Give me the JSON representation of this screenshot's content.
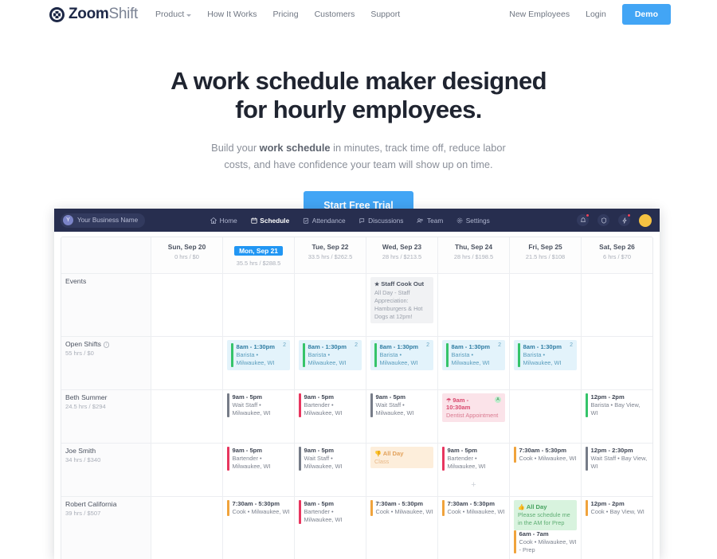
{
  "site_nav": {
    "brand": {
      "part1": "Zoom",
      "part2": "Shift",
      "icon": "zoomshift-logo-icon"
    },
    "links": [
      {
        "label": "Product",
        "has_caret": true
      },
      {
        "label": "How It Works",
        "has_caret": false
      },
      {
        "label": "Pricing",
        "has_caret": false
      },
      {
        "label": "Customers",
        "has_caret": false
      },
      {
        "label": "Support",
        "has_caret": false
      }
    ],
    "right": [
      {
        "label": "New Employees"
      },
      {
        "label": "Login"
      }
    ],
    "demo_button": "Demo",
    "accent_color": "#42a5f5"
  },
  "hero": {
    "heading_line1": "A work schedule maker designed for",
    "heading_line2": "hourly employees.",
    "sub_pre": "Build your ",
    "sub_bold": "work schedule",
    "sub_post": " in minutes, track time off, reduce labor costs, and have confidence your team will show up on time.",
    "cta_label": "Start Free Trial"
  },
  "app": {
    "business_name": "Your Business Name",
    "business_initial": "Y",
    "menu": [
      {
        "label": "Home",
        "icon": "home-icon",
        "active": false
      },
      {
        "label": "Schedule",
        "icon": "calendar-icon",
        "active": true
      },
      {
        "label": "Attendance",
        "icon": "clipboard-check-icon",
        "active": false
      },
      {
        "label": "Discussions",
        "icon": "chat-icon",
        "active": false
      },
      {
        "label": "Team",
        "icon": "people-icon",
        "active": false
      },
      {
        "label": "Settings",
        "icon": "gear-icon",
        "active": false
      }
    ],
    "nav_icons": [
      {
        "name": "bell-icon",
        "has_dot": true
      },
      {
        "name": "shield-icon",
        "has_dot": false
      },
      {
        "name": "lightning-icon",
        "has_dot": true
      }
    ],
    "avatar": "user-avatar"
  },
  "calendar": {
    "days": [
      {
        "label": "Sun, Sep 20",
        "sub": "0 hrs / $0",
        "selected": false
      },
      {
        "label": "Mon, Sep 21",
        "sub": "35.5 hrs / $288.5",
        "selected": true
      },
      {
        "label": "Tue, Sep 22",
        "sub": "33.5 hrs / $262.5",
        "selected": false
      },
      {
        "label": "Wed, Sep 23",
        "sub": "28 hrs / $213.5",
        "selected": false
      },
      {
        "label": "Thu, Sep 24",
        "sub": "28 hrs / $198.5",
        "selected": false
      },
      {
        "label": "Fri, Sep 25",
        "sub": "21.5 hrs / $108",
        "selected": false
      },
      {
        "label": "Sat, Sep 26",
        "sub": "6 hrs / $70",
        "selected": false
      }
    ],
    "events_row": {
      "label": "Events",
      "event": {
        "title": "Staff Cook Out",
        "desc": "All Day - Staff Appreciation: Hamburgers & Hot Dogs at 12pm!",
        "icon": "star-icon",
        "day_index": 3
      }
    },
    "open_shifts_row": {
      "label": "Open Shifts",
      "sub": "55 hrs / $0",
      "card_time": "8am - 1:30pm",
      "card_desc": "Barista • Milwaukee, WI",
      "count": "2",
      "day_indexes": [
        1,
        2,
        3,
        4,
        5
      ]
    },
    "employees": [
      {
        "name": "Beth Summer",
        "sub": "24.5 hrs / $294",
        "cells": [
          {},
          {
            "type": "shift",
            "time": "9am - 5pm",
            "desc": "Wait Staff • Milwaukee, WI",
            "color": "#767c88"
          },
          {
            "type": "shift",
            "time": "9am - 5pm",
            "desc": "Bartender • Milwaukee, WI",
            "color": "#e8365f"
          },
          {
            "type": "shift",
            "time": "9am - 5pm",
            "desc": "Wait Staff • Milwaukee, WI",
            "color": "#767c88"
          },
          {
            "type": "timeoff",
            "time": "9am - 10:30am",
            "desc": "Dentist Appointment",
            "badge": "A",
            "icon": "umbrella-icon"
          },
          {},
          {
            "type": "shift",
            "time": "12pm - 2pm",
            "desc": "Barista • Bay View, WI",
            "color": "#35c46a"
          }
        ]
      },
      {
        "name": "Joe Smith",
        "sub": "34 hrs / $340",
        "cells": [
          {},
          {
            "type": "shift",
            "time": "9am - 5pm",
            "desc": "Bartender • Milwaukee, WI",
            "color": "#e8365f"
          },
          {
            "type": "shift",
            "time": "9am - 5pm",
            "desc": "Wait Staff • Milwaukee, WI",
            "color": "#767c88"
          },
          {
            "type": "avail_amber",
            "time": "All Day",
            "desc": "Class",
            "icon": "thumbs-down-icon"
          },
          {
            "type": "shift",
            "time": "9am - 5pm",
            "desc": "Bartender • Milwaukee, WI",
            "color": "#e8365f",
            "add_button": true
          },
          {
            "type": "shift",
            "time": "7:30am - 5:30pm",
            "desc": "Cook • Milwaukee, WI",
            "color": "#f0a33c"
          },
          {
            "type": "shift",
            "time": "12pm - 2:30pm",
            "desc": "Wait Staff • Bay View, WI",
            "color": "#767c88"
          }
        ]
      },
      {
        "name": "Robert California",
        "sub": "39 hrs / $507",
        "cells": [
          {},
          {
            "type": "shift",
            "time": "7:30am - 5:30pm",
            "desc": "Cook • Milwaukee, WI",
            "color": "#f0a33c"
          },
          {
            "type": "shift",
            "time": "9am - 5pm",
            "desc": "Bartender • Milwaukee, WI",
            "color": "#e8365f"
          },
          {
            "type": "shift",
            "time": "7:30am - 5:30pm",
            "desc": "Cook • Milwaukee, WI",
            "color": "#f0a33c"
          },
          {
            "type": "shift",
            "time": "7:30am - 5:30pm",
            "desc": "Cook • Milwaukee, WI",
            "color": "#f0a33c"
          },
          {
            "type": "avail_green_plus_shift",
            "avail_time": "All Day",
            "avail_desc": "Please schedule me in the AM for Prep",
            "avail_icon": "thumbs-up-icon",
            "time": "6am - 7am",
            "desc": "Cook • Milwaukee, WI - Prep",
            "color": "#f0a33c"
          },
          {
            "type": "shift",
            "time": "12pm - 2pm",
            "desc": "Cook • Bay View, WI",
            "color": "#f0a33c"
          }
        ]
      }
    ]
  }
}
